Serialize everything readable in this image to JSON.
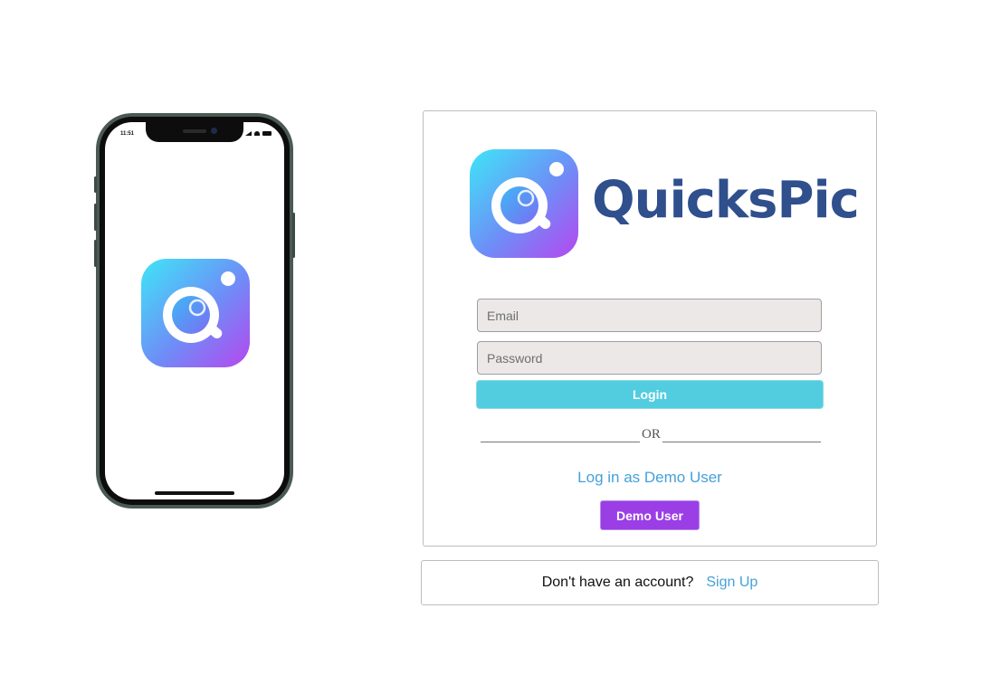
{
  "colors": {
    "brand_text": "#2f4f8d",
    "login_button": "#52cde0",
    "demo_button": "#9b3ee6",
    "link": "#45a1d8"
  },
  "phone": {
    "status_time": "11:51",
    "icons": [
      "signal-icon",
      "wifi-icon",
      "battery-icon"
    ]
  },
  "brand": {
    "name": "QuicksPic",
    "logo_icon": "quickspic-logo-icon"
  },
  "form": {
    "email_placeholder": "Email",
    "password_placeholder": "Password",
    "login_label": "Login"
  },
  "divider": {
    "text": "OR"
  },
  "demo": {
    "link_label": "Log in as Demo User",
    "button_label": "Demo User"
  },
  "signup": {
    "prompt": "Don't have an account?",
    "link_label": "Sign Up"
  }
}
